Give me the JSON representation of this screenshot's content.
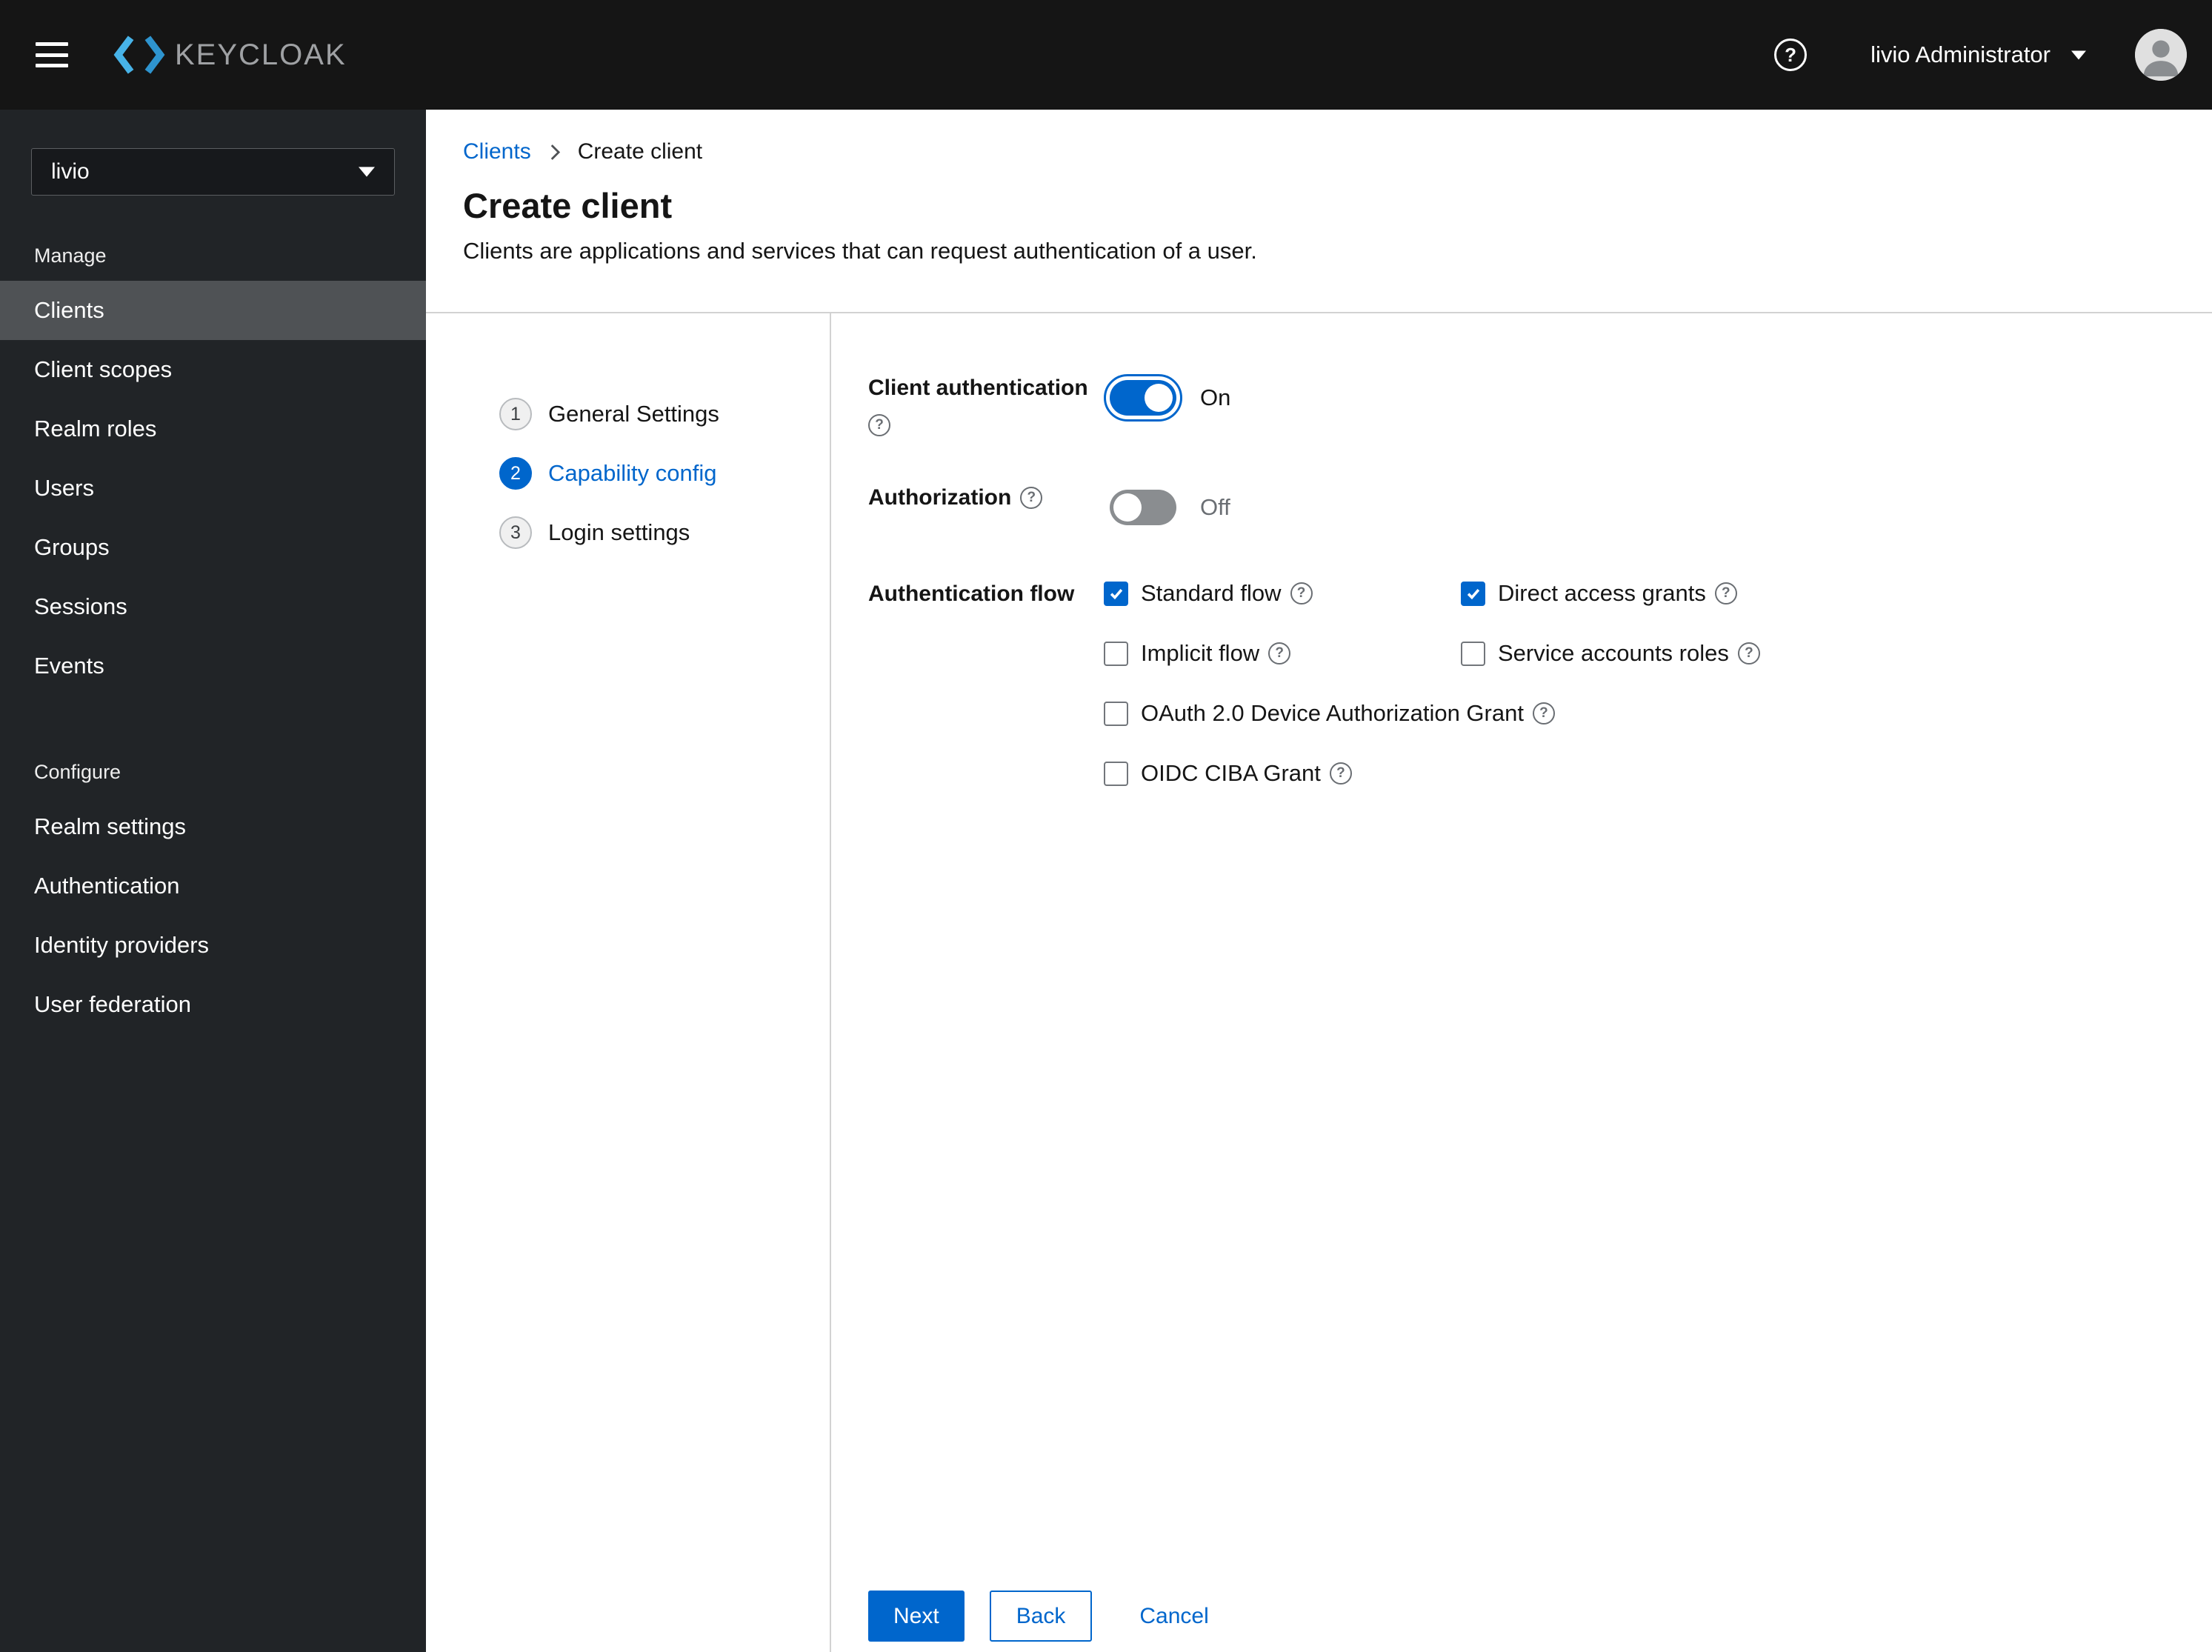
{
  "masthead": {
    "brand": "KEYCLOAK",
    "user_menu": "livio Administrator"
  },
  "sidebar": {
    "realm_selector": "livio",
    "sections": [
      {
        "label": "Manage",
        "items": [
          {
            "label": "Clients",
            "active": true
          },
          {
            "label": "Client scopes",
            "active": false
          },
          {
            "label": "Realm roles",
            "active": false
          },
          {
            "label": "Users",
            "active": false
          },
          {
            "label": "Groups",
            "active": false
          },
          {
            "label": "Sessions",
            "active": false
          },
          {
            "label": "Events",
            "active": false
          }
        ]
      },
      {
        "label": "Configure",
        "items": [
          {
            "label": "Realm settings",
            "active": false
          },
          {
            "label": "Authentication",
            "active": false
          },
          {
            "label": "Identity providers",
            "active": false
          },
          {
            "label": "User federation",
            "active": false
          }
        ]
      }
    ]
  },
  "breadcrumb": {
    "root": "Clients",
    "current": "Create client"
  },
  "page": {
    "title": "Create client",
    "subtitle": "Clients are applications and services that can request authentication of a user."
  },
  "wizard": {
    "steps": [
      {
        "num": "1",
        "label": "General Settings",
        "active": false
      },
      {
        "num": "2",
        "label": "Capability config",
        "active": true
      },
      {
        "num": "3",
        "label": "Login settings",
        "active": false
      }
    ]
  },
  "form": {
    "client_authentication": {
      "label": "Client authentication",
      "value": "On",
      "on": true
    },
    "authorization": {
      "label": "Authorization",
      "value": "Off",
      "on": false
    },
    "authentication_flow": {
      "label": "Authentication flow",
      "options": [
        {
          "label": "Standard flow",
          "checked": true
        },
        {
          "label": "Direct access grants",
          "checked": true
        },
        {
          "label": "Implicit flow",
          "checked": false
        },
        {
          "label": "Service accounts roles",
          "checked": false
        },
        {
          "label": "OAuth 2.0 Device Authorization Grant",
          "checked": false
        },
        {
          "label": "OIDC CIBA Grant",
          "checked": false
        }
      ]
    },
    "actions": {
      "next": "Next",
      "back": "Back",
      "cancel": "Cancel"
    }
  },
  "colors": {
    "accent": "#0066cc",
    "masthead_bg": "#151515",
    "sidebar_bg": "#212427",
    "sidebar_active_bg": "#4f5255",
    "divider": "#d2d2d2"
  }
}
